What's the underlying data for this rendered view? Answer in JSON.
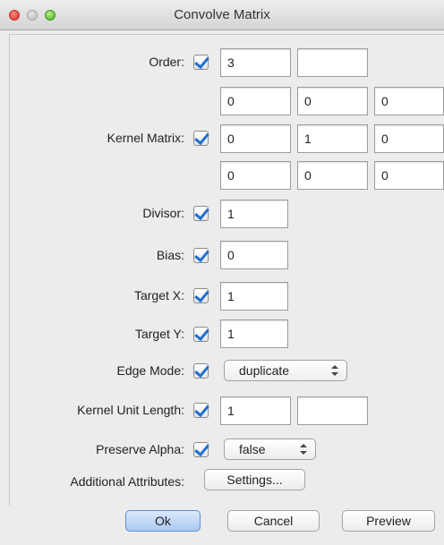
{
  "window": {
    "title": "Convolve Matrix"
  },
  "order": {
    "label": "Order:",
    "checked": true,
    "value_x": "3",
    "value_y": ""
  },
  "kernel_matrix": {
    "label": "Kernel Matrix:",
    "checked": true,
    "rows": [
      [
        "0",
        "0",
        "0"
      ],
      [
        "0",
        "1",
        "0"
      ],
      [
        "0",
        "0",
        "0"
      ]
    ]
  },
  "divisor": {
    "label": "Divisor:",
    "checked": true,
    "value": "1"
  },
  "bias": {
    "label": "Bias:",
    "checked": true,
    "value": "0"
  },
  "target_x": {
    "label": "Target X:",
    "checked": true,
    "value": "1"
  },
  "target_y": {
    "label": "Target Y:",
    "checked": true,
    "value": "1"
  },
  "edge_mode": {
    "label": "Edge Mode:",
    "checked": true,
    "value": "duplicate"
  },
  "kernel_unit_length": {
    "label": "Kernel Unit Length:",
    "checked": true,
    "value_x": "1",
    "value_y": ""
  },
  "preserve_alpha": {
    "label": "Preserve Alpha:",
    "checked": true,
    "value": "false"
  },
  "additional_attributes": {
    "label": "Additional Attributes:",
    "button": "Settings..."
  },
  "buttons": {
    "ok": "Ok",
    "cancel": "Cancel",
    "preview": "Preview"
  }
}
